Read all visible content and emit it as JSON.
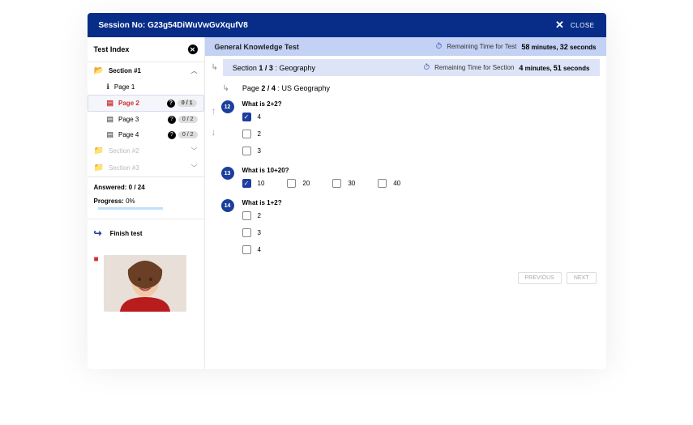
{
  "header": {
    "session_label": "Session No: G23g54DiWuVwGvXqufV8",
    "close": "CLOSE"
  },
  "sidebar": {
    "title": "Test Index",
    "sections": [
      {
        "label": "Section #1",
        "active": true,
        "expanded": true
      },
      {
        "label": "Section #2",
        "active": false
      },
      {
        "label": "Section #3",
        "active": false
      }
    ],
    "pages": [
      {
        "label": "Page 1",
        "icon": "info",
        "count": null,
        "current": false
      },
      {
        "label": "Page 2",
        "icon": "doc",
        "count": "0 / 1",
        "current": true
      },
      {
        "label": "Page 3",
        "icon": "doc",
        "count": "0 / 2",
        "current": false
      },
      {
        "label": "Page 4",
        "icon": "doc",
        "count": "0 / 2",
        "current": false
      }
    ],
    "answered_label": "Answered:",
    "answered_value": "0 / 24",
    "progress_label": "Progress:",
    "progress_value": "0%",
    "finish": "Finish test"
  },
  "main": {
    "test_title": "General Knowledge Test",
    "timer_test_label": "Remaining Time for Test",
    "timer_test_min": "58",
    "timer_test_sec": "32",
    "timer_test_units_min": "minutes,",
    "timer_test_units_sec": "seconds",
    "section_line": {
      "prefix": "Section ",
      "num": "1 / 3",
      "suffix": " : Geography"
    },
    "timer_section_label": "Remaining Time for Section",
    "timer_section_min": "4",
    "timer_section_sec": "51",
    "page_line": {
      "prefix": "Page ",
      "num": "2 / 4",
      "suffix": " : US Geography"
    },
    "questions": [
      {
        "num": "12",
        "title": "What is 2+2?",
        "layout": "vertical",
        "options": [
          {
            "label": "4",
            "checked": true
          },
          {
            "label": "2",
            "checked": false
          },
          {
            "label": "3",
            "checked": false
          }
        ]
      },
      {
        "num": "13",
        "title": "What is 10+20?",
        "layout": "horizontal",
        "options": [
          {
            "label": "10",
            "checked": true
          },
          {
            "label": "20",
            "checked": false
          },
          {
            "label": "30",
            "checked": false
          },
          {
            "label": "40",
            "checked": false
          }
        ]
      },
      {
        "num": "14",
        "title": "What is 1+2?",
        "layout": "vertical",
        "options": [
          {
            "label": "2",
            "checked": false
          },
          {
            "label": "3",
            "checked": false
          },
          {
            "label": "4",
            "checked": false
          }
        ]
      }
    ],
    "prev": "PREVIOUS",
    "next": "NEXT"
  }
}
